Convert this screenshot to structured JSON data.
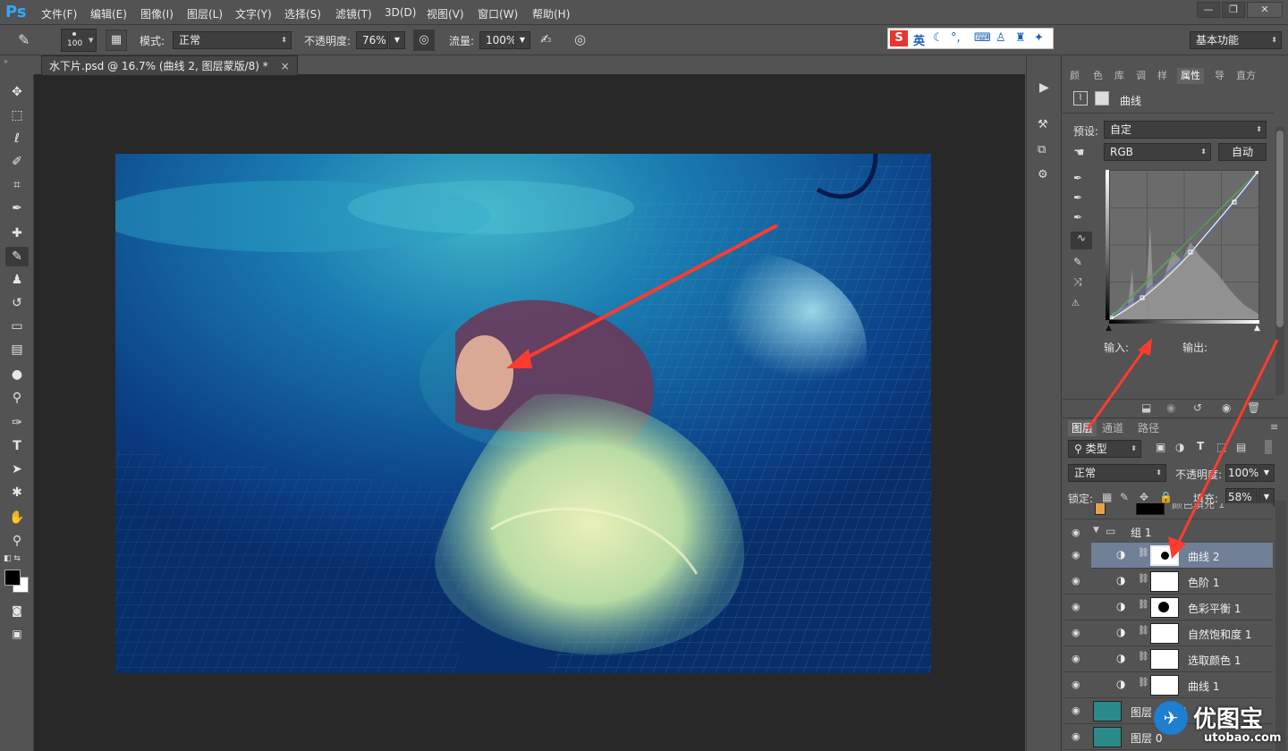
{
  "app": {
    "logo": "Ps"
  },
  "menu": [
    "文件(F)",
    "编辑(E)",
    "图像(I)",
    "图层(L)",
    "文字(Y)",
    "选择(S)",
    "滤镜(T)",
    "3D(D)",
    "视图(V)",
    "窗口(W)",
    "帮助(H)"
  ],
  "window_controls": {
    "minimize": "—",
    "restore": "❐",
    "close": "✕"
  },
  "options": {
    "brush_size": "100",
    "mode_label": "模式:",
    "mode_value": "正常",
    "opacity_label": "不透明度:",
    "opacity_value": "76%",
    "flow_label": "流量:",
    "flow_value": "100%",
    "workspace": "基本功能",
    "ime_label": "英"
  },
  "document_tab": {
    "title": "水下片.psd @ 16.7% (曲线 2, 图层蒙版/8) *",
    "close": "×"
  },
  "properties": {
    "tabs": [
      "颜",
      "色",
      "库",
      "调",
      "样",
      "属性",
      "导",
      "直方"
    ],
    "active_tab": "属性",
    "title": "曲线",
    "preset_label": "预设:",
    "preset_value": "自定",
    "channel_value": "RGB",
    "auto_button": "自动",
    "input_label": "输入:",
    "output_label": "输出:"
  },
  "layers_panel": {
    "tabs": [
      "图层",
      "通道",
      "路径"
    ],
    "filter_value": "类型",
    "blend_value": "正常",
    "opacity_label": "不透明度:",
    "opacity_value": "100%",
    "lock_label": "锁定:",
    "fill_label": "填充:",
    "fill_value": "58%",
    "layers": [
      {
        "name": "颜色填充 1",
        "kind": "fill",
        "selected": false
      },
      {
        "name": "组 1",
        "kind": "group",
        "selected": false
      },
      {
        "name": "曲线 2",
        "kind": "adjust",
        "selected": true
      },
      {
        "name": "色阶 1",
        "kind": "adjust",
        "selected": false
      },
      {
        "name": "色彩平衡 1",
        "kind": "adjust",
        "selected": false
      },
      {
        "name": "自然饱和度 1",
        "kind": "adjust",
        "selected": false
      },
      {
        "name": "选取颜色 1",
        "kind": "adjust",
        "selected": false
      },
      {
        "name": "曲线 1",
        "kind": "adjust",
        "selected": false
      },
      {
        "name": "图层 0 拷贝",
        "kind": "image",
        "selected": false
      },
      {
        "name": "图层 0",
        "kind": "image",
        "selected": false
      }
    ]
  },
  "watermark": {
    "brand": "优图宝",
    "url": "utobao.com"
  },
  "colors": {
    "accent": "#31a8ff",
    "selection": "#6e7f96",
    "arrow": "#ff3b30",
    "panel": "#535353",
    "canvas_bg": "#282828"
  }
}
